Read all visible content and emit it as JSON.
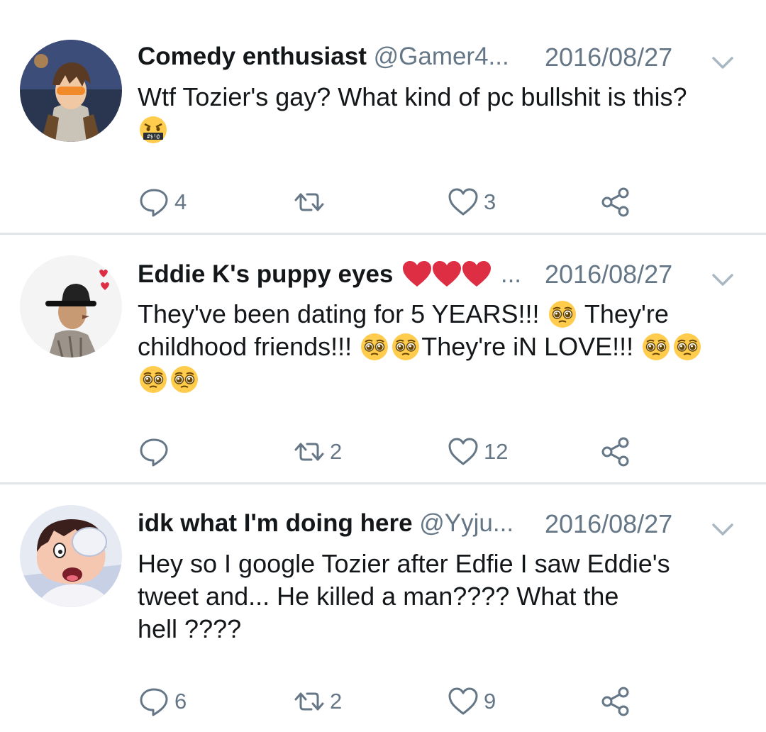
{
  "tweets": [
    {
      "name": "Comedy enthusiast",
      "handle": "@Gamer4...",
      "date": "2016/08/27",
      "text_lines": [
        "Wtf Tozier's gay? What kind of pc bullshit is this?"
      ],
      "trailing_emoji": [
        "face-with-symbols-on-mouth-emoji"
      ],
      "counts": {
        "reply": "4",
        "retweet": "",
        "like": "3"
      }
    },
    {
      "name": "Eddie K's puppy eyes",
      "name_emoji": [
        "red-heart-emoji",
        "red-heart-emoji",
        "red-heart-emoji"
      ],
      "handle": "...",
      "date": "2016/08/27",
      "text_lines": [
        "They've been dating for 5 YEARS!!!",
        "They're",
        "childhood friends!!!",
        "They're iN LOVE!!!"
      ],
      "counts": {
        "reply": "",
        "retweet": "2",
        "like": "12"
      }
    },
    {
      "name": "idk what I'm doing here",
      "handle": "@Yyju...",
      "date": "2016/08/27",
      "text_lines": [
        "Hey so I google Tozier after Edfie I saw Eddie's",
        "tweet and... He killed a man???? What the",
        "hell ????"
      ],
      "counts": {
        "reply": "6",
        "retweet": "2",
        "like": "9"
      }
    }
  ],
  "colors": {
    "text": "#14171a",
    "muted": "#657786",
    "divider": "#e1e5e8",
    "heart": "#dd2e44",
    "emoji_face": "#ffcc4d"
  }
}
